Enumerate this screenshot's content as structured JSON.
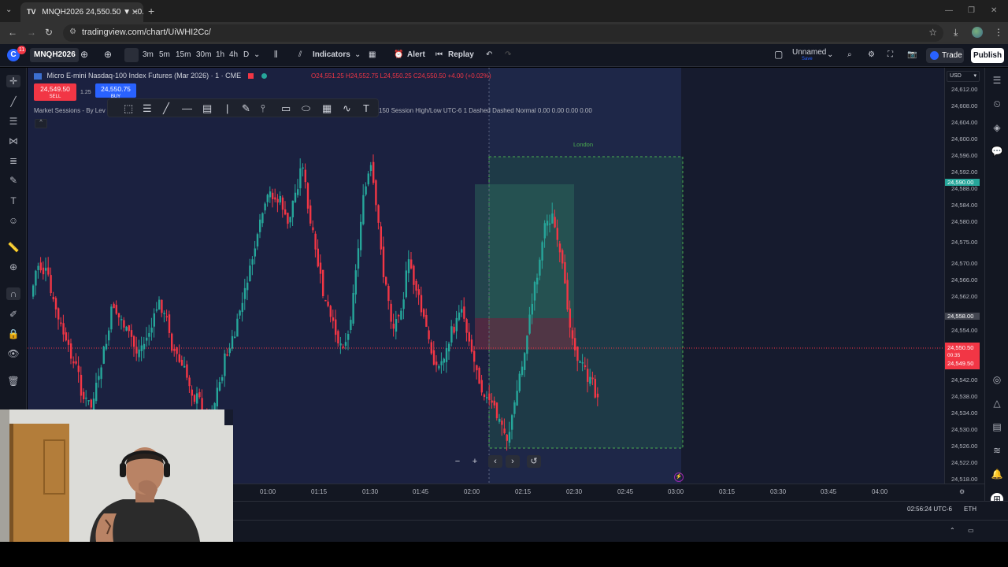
{
  "browser": {
    "tab_title": "MNQH2026 24,550.50 ▼ −0.51...",
    "tab_icon": "TV",
    "url": "tradingview.com/chart/UiWHI2Cc/",
    "new_tab": "+",
    "close_tab": "✕"
  },
  "header": {
    "avatar_letter": "C",
    "notifications": "11",
    "symbol": "MNQH2026",
    "timeframes": [
      "1m",
      "3m",
      "5m",
      "15m",
      "30m",
      "1h",
      "4h",
      "D"
    ],
    "indicators_label": "Indicators",
    "alert_label": "Alert",
    "replay_label": "Replay",
    "layout_name": "Unnamed",
    "layout_sub": "Save",
    "trade_label": "Trade",
    "publish_label": "Publish"
  },
  "legend": {
    "title": "Micro E-mini Nasdaq-100 Index Futures (Mar 2026) · 1 · CME",
    "ohlc": "O24,551.25 H24,552.75 L24,550.25 C24,550.50 +4.00 (+0.02%)",
    "sell_price": "24,549.50",
    "sell_label": "SELL",
    "buy_price": "24,550.75",
    "buy_label": "BUY",
    "spread": "1.25",
    "indicator_name": "Market Sessions - By Lev",
    "session_info": "150 Session High/Low UTC-6 1 Dashed Dashed Normal  0.00  0.00  0.00  0.00",
    "collapse": "^"
  },
  "chart": {
    "session_label": "London",
    "currency": "USD",
    "price_labels": [
      "24,612.00",
      "24,608.00",
      "24,604.00",
      "24,600.00",
      "24,596.00",
      "24,592.00",
      "24,588.00",
      "24,584.00",
      "24,580.00",
      "24,575.00",
      "24,570.00",
      "24,566.00",
      "24,562.00",
      "24,554.00",
      "24,546.00",
      "24,542.00",
      "24,538.00",
      "24,534.00",
      "24,530.00",
      "24,526.00",
      "24,522.00",
      "24,518.00"
    ],
    "green_tag": "24,590.00",
    "grey_tag": "24,558.00",
    "red_tag_price": "24,550.50",
    "red_tag_timer": "00:35",
    "red_tag_bid": "24,549.50",
    "time_labels": [
      ":45",
      "01:00",
      "01:15",
      "01:30",
      "01:45",
      "02:00",
      "02:15",
      "02:30",
      "02:45",
      "03:00",
      "03:15",
      "03:30",
      "03:45",
      "04:00"
    ],
    "colors": {
      "up": "#26a69a",
      "down": "#f23645",
      "session": "#2f6f5e",
      "background": "#161b2e"
    }
  },
  "status": {
    "clock": "02:56:24 UTC-6",
    "session": "ETH"
  }
}
